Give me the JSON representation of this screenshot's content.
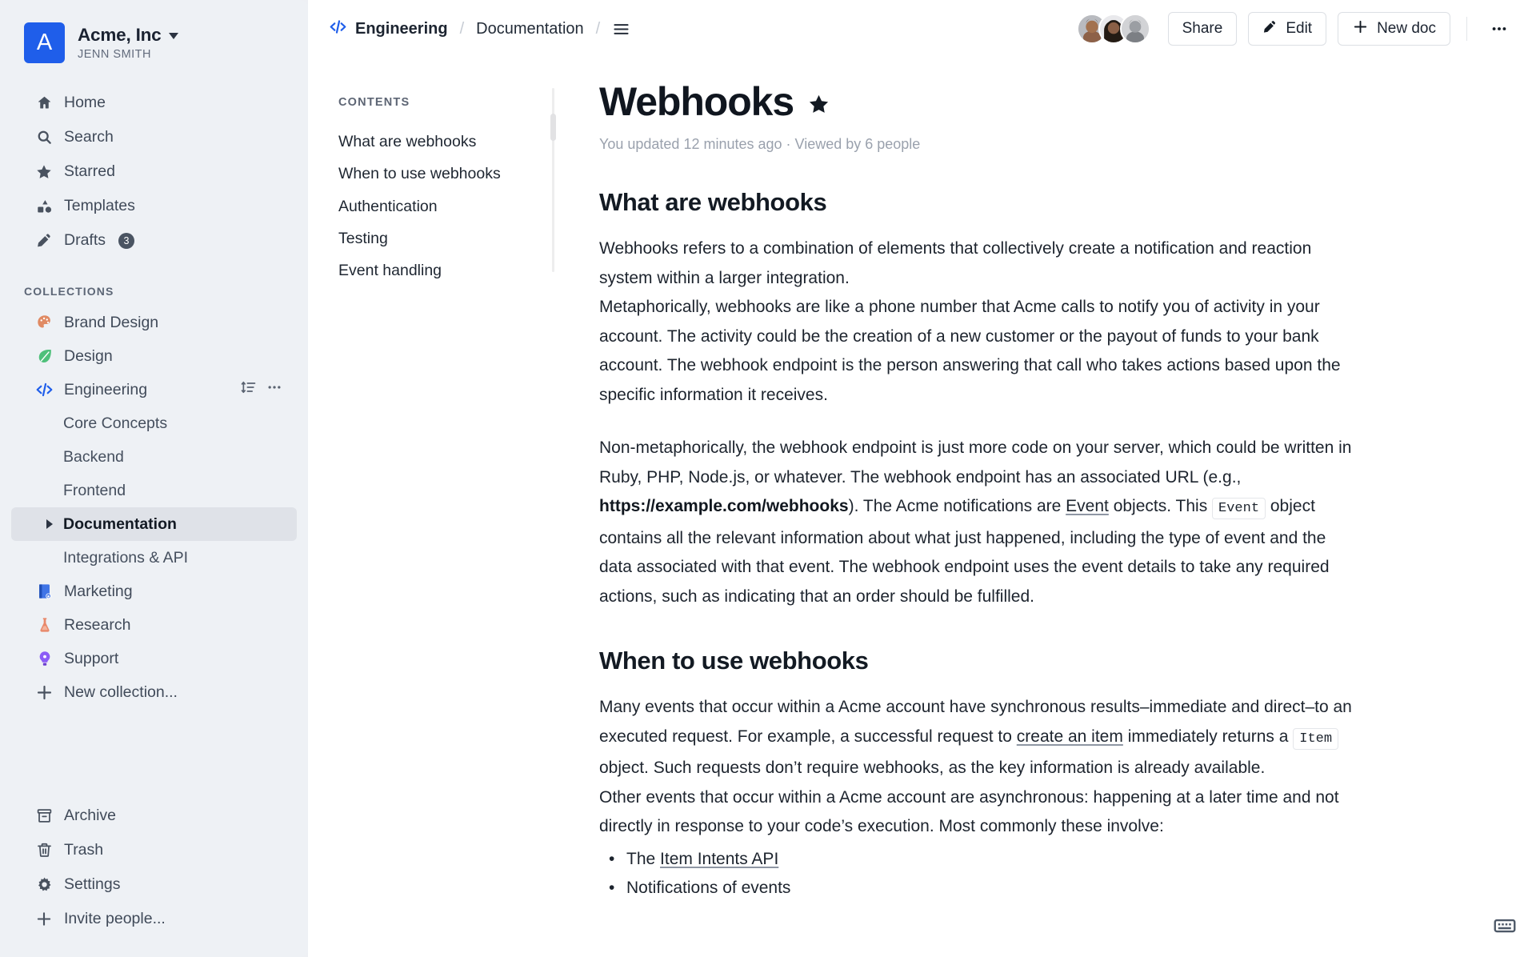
{
  "sidebar": {
    "team": {
      "avatar_letter": "A",
      "name": "Acme, Inc",
      "user": "JENN SMITH"
    },
    "nav": [
      {
        "label": "Home",
        "icon": "home-icon"
      },
      {
        "label": "Search",
        "icon": "search-icon"
      },
      {
        "label": "Starred",
        "icon": "star-icon"
      },
      {
        "label": "Templates",
        "icon": "templates-icon"
      },
      {
        "label": "Drafts",
        "icon": "pencil-icon",
        "badge": "3"
      }
    ],
    "collections_label": "COLLECTIONS",
    "collections": [
      {
        "label": "Brand Design",
        "icon": "palette-emoji"
      },
      {
        "label": "Design",
        "icon": "leaf-emoji"
      },
      {
        "label": "Engineering",
        "icon": "code-emoji",
        "expanded": true,
        "actions": [
          "sort-icon",
          "more-icon"
        ],
        "children": [
          {
            "label": "Core Concepts",
            "active": false
          },
          {
            "label": "Backend",
            "active": false
          },
          {
            "label": "Frontend",
            "active": false
          },
          {
            "label": "Documentation",
            "active": true
          },
          {
            "label": "Integrations & API",
            "active": false
          }
        ]
      },
      {
        "label": "Marketing",
        "icon": "book-emoji"
      },
      {
        "label": "Research",
        "icon": "flask-emoji"
      },
      {
        "label": "Support",
        "icon": "bulb-emoji"
      },
      {
        "label": "New collection...",
        "icon": "plus-icon"
      }
    ],
    "bottom": [
      {
        "label": "Archive",
        "icon": "archive-icon"
      },
      {
        "label": "Trash",
        "icon": "trash-icon"
      },
      {
        "label": "Settings",
        "icon": "gear-icon"
      },
      {
        "label": "Invite people...",
        "icon": "plus-icon"
      }
    ]
  },
  "topbar": {
    "breadcrumb": [
      {
        "label": "Engineering",
        "icon": "code-icon"
      },
      {
        "label": "Documentation"
      }
    ],
    "separator": "/",
    "menu_icon": "hamburger-icon",
    "share_label": "Share",
    "edit_label": "Edit",
    "new_doc_label": "New doc",
    "more_label": "•••",
    "collaborators": 3
  },
  "toc": {
    "label": "CONTENTS",
    "items": [
      "What are webhooks",
      "When to use webhooks",
      "Authentication",
      "Testing",
      "Event handling"
    ]
  },
  "document": {
    "title": "Webhooks",
    "starred": true,
    "meta": "You updated 12 minutes ago · Viewed by 6 people",
    "section1_heading": "What are webhooks",
    "p1": "Webhooks refers to a combination of elements that collectively create a notification and reaction system within a larger integration.",
    "p2": "Metaphorically, webhooks are like a phone number that Acme calls to notify you of activity in your account. The activity could be the creation of a new customer or the payout of funds to your bank account. The webhook endpoint is the person answering that call who takes actions based upon the specific information it receives.",
    "p3_a": "Non-metaphorically, the webhook endpoint is just more code on your server, which could be written in Ruby, PHP, Node.js, or whatever. The webhook endpoint has an associated URL (e.g., ",
    "p3_url": "https://example.com/webhooks",
    "p3_b": "). The Acme notifications are ",
    "p3_link": "Event",
    "p3_c": " objects. This ",
    "p3_code": "Event",
    "p3_d": " object contains all the relevant information about what just happened, including the type of event and the data associated with that event. The webhook endpoint uses the event details to take any required actions, such as indicating that an order should be fulfilled.",
    "section2_heading": "When to use webhooks",
    "p4_a": "Many events that occur within a Acme account have synchronous results–immediate and direct–to an executed request. For example, a successful request to ",
    "p4_link": "create an item",
    "p4_b": " immediately returns a ",
    "p4_code": "Item",
    "p4_c": " object. Such requests don’t require webhooks, as the key information is already available.",
    "p5": "Other events that occur within a Acme account are asynchronous: happening at a later time and not directly in response to your code’s execution. Most commonly these involve:",
    "bullets": [
      {
        "prefix": "The ",
        "link": "Item Intents API"
      },
      {
        "prefix": "Notifications of events",
        "link": ""
      }
    ]
  },
  "footer": {
    "keyboard_icon": "keyboard-icon"
  },
  "colors": {
    "accent": "#1f5eea",
    "sidebar_bg": "#eef1f5",
    "active_item_bg": "#dfe2e8",
    "text": "#1d242e",
    "muted": "#9aa1ad"
  }
}
